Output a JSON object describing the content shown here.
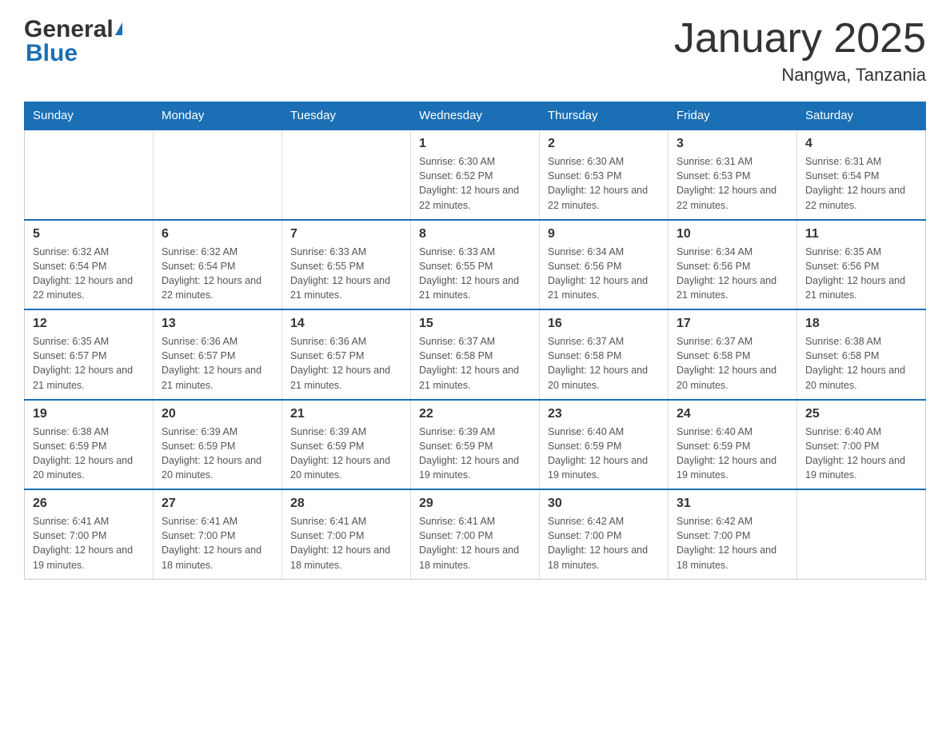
{
  "header": {
    "logo_general": "General",
    "logo_arrow": "▶",
    "logo_blue": "Blue",
    "month_title": "January 2025",
    "location": "Nangwa, Tanzania"
  },
  "weekdays": [
    "Sunday",
    "Monday",
    "Tuesday",
    "Wednesday",
    "Thursday",
    "Friday",
    "Saturday"
  ],
  "weeks": [
    [
      {
        "day": "",
        "info": ""
      },
      {
        "day": "",
        "info": ""
      },
      {
        "day": "",
        "info": ""
      },
      {
        "day": "1",
        "info": "Sunrise: 6:30 AM\nSunset: 6:52 PM\nDaylight: 12 hours and 22 minutes."
      },
      {
        "day": "2",
        "info": "Sunrise: 6:30 AM\nSunset: 6:53 PM\nDaylight: 12 hours and 22 minutes."
      },
      {
        "day": "3",
        "info": "Sunrise: 6:31 AM\nSunset: 6:53 PM\nDaylight: 12 hours and 22 minutes."
      },
      {
        "day": "4",
        "info": "Sunrise: 6:31 AM\nSunset: 6:54 PM\nDaylight: 12 hours and 22 minutes."
      }
    ],
    [
      {
        "day": "5",
        "info": "Sunrise: 6:32 AM\nSunset: 6:54 PM\nDaylight: 12 hours and 22 minutes."
      },
      {
        "day": "6",
        "info": "Sunrise: 6:32 AM\nSunset: 6:54 PM\nDaylight: 12 hours and 22 minutes."
      },
      {
        "day": "7",
        "info": "Sunrise: 6:33 AM\nSunset: 6:55 PM\nDaylight: 12 hours and 21 minutes."
      },
      {
        "day": "8",
        "info": "Sunrise: 6:33 AM\nSunset: 6:55 PM\nDaylight: 12 hours and 21 minutes."
      },
      {
        "day": "9",
        "info": "Sunrise: 6:34 AM\nSunset: 6:56 PM\nDaylight: 12 hours and 21 minutes."
      },
      {
        "day": "10",
        "info": "Sunrise: 6:34 AM\nSunset: 6:56 PM\nDaylight: 12 hours and 21 minutes."
      },
      {
        "day": "11",
        "info": "Sunrise: 6:35 AM\nSunset: 6:56 PM\nDaylight: 12 hours and 21 minutes."
      }
    ],
    [
      {
        "day": "12",
        "info": "Sunrise: 6:35 AM\nSunset: 6:57 PM\nDaylight: 12 hours and 21 minutes."
      },
      {
        "day": "13",
        "info": "Sunrise: 6:36 AM\nSunset: 6:57 PM\nDaylight: 12 hours and 21 minutes."
      },
      {
        "day": "14",
        "info": "Sunrise: 6:36 AM\nSunset: 6:57 PM\nDaylight: 12 hours and 21 minutes."
      },
      {
        "day": "15",
        "info": "Sunrise: 6:37 AM\nSunset: 6:58 PM\nDaylight: 12 hours and 21 minutes."
      },
      {
        "day": "16",
        "info": "Sunrise: 6:37 AM\nSunset: 6:58 PM\nDaylight: 12 hours and 20 minutes."
      },
      {
        "day": "17",
        "info": "Sunrise: 6:37 AM\nSunset: 6:58 PM\nDaylight: 12 hours and 20 minutes."
      },
      {
        "day": "18",
        "info": "Sunrise: 6:38 AM\nSunset: 6:58 PM\nDaylight: 12 hours and 20 minutes."
      }
    ],
    [
      {
        "day": "19",
        "info": "Sunrise: 6:38 AM\nSunset: 6:59 PM\nDaylight: 12 hours and 20 minutes."
      },
      {
        "day": "20",
        "info": "Sunrise: 6:39 AM\nSunset: 6:59 PM\nDaylight: 12 hours and 20 minutes."
      },
      {
        "day": "21",
        "info": "Sunrise: 6:39 AM\nSunset: 6:59 PM\nDaylight: 12 hours and 20 minutes."
      },
      {
        "day": "22",
        "info": "Sunrise: 6:39 AM\nSunset: 6:59 PM\nDaylight: 12 hours and 19 minutes."
      },
      {
        "day": "23",
        "info": "Sunrise: 6:40 AM\nSunset: 6:59 PM\nDaylight: 12 hours and 19 minutes."
      },
      {
        "day": "24",
        "info": "Sunrise: 6:40 AM\nSunset: 6:59 PM\nDaylight: 12 hours and 19 minutes."
      },
      {
        "day": "25",
        "info": "Sunrise: 6:40 AM\nSunset: 7:00 PM\nDaylight: 12 hours and 19 minutes."
      }
    ],
    [
      {
        "day": "26",
        "info": "Sunrise: 6:41 AM\nSunset: 7:00 PM\nDaylight: 12 hours and 19 minutes."
      },
      {
        "day": "27",
        "info": "Sunrise: 6:41 AM\nSunset: 7:00 PM\nDaylight: 12 hours and 18 minutes."
      },
      {
        "day": "28",
        "info": "Sunrise: 6:41 AM\nSunset: 7:00 PM\nDaylight: 12 hours and 18 minutes."
      },
      {
        "day": "29",
        "info": "Sunrise: 6:41 AM\nSunset: 7:00 PM\nDaylight: 12 hours and 18 minutes."
      },
      {
        "day": "30",
        "info": "Sunrise: 6:42 AM\nSunset: 7:00 PM\nDaylight: 12 hours and 18 minutes."
      },
      {
        "day": "31",
        "info": "Sunrise: 6:42 AM\nSunset: 7:00 PM\nDaylight: 12 hours and 18 minutes."
      },
      {
        "day": "",
        "info": ""
      }
    ]
  ]
}
